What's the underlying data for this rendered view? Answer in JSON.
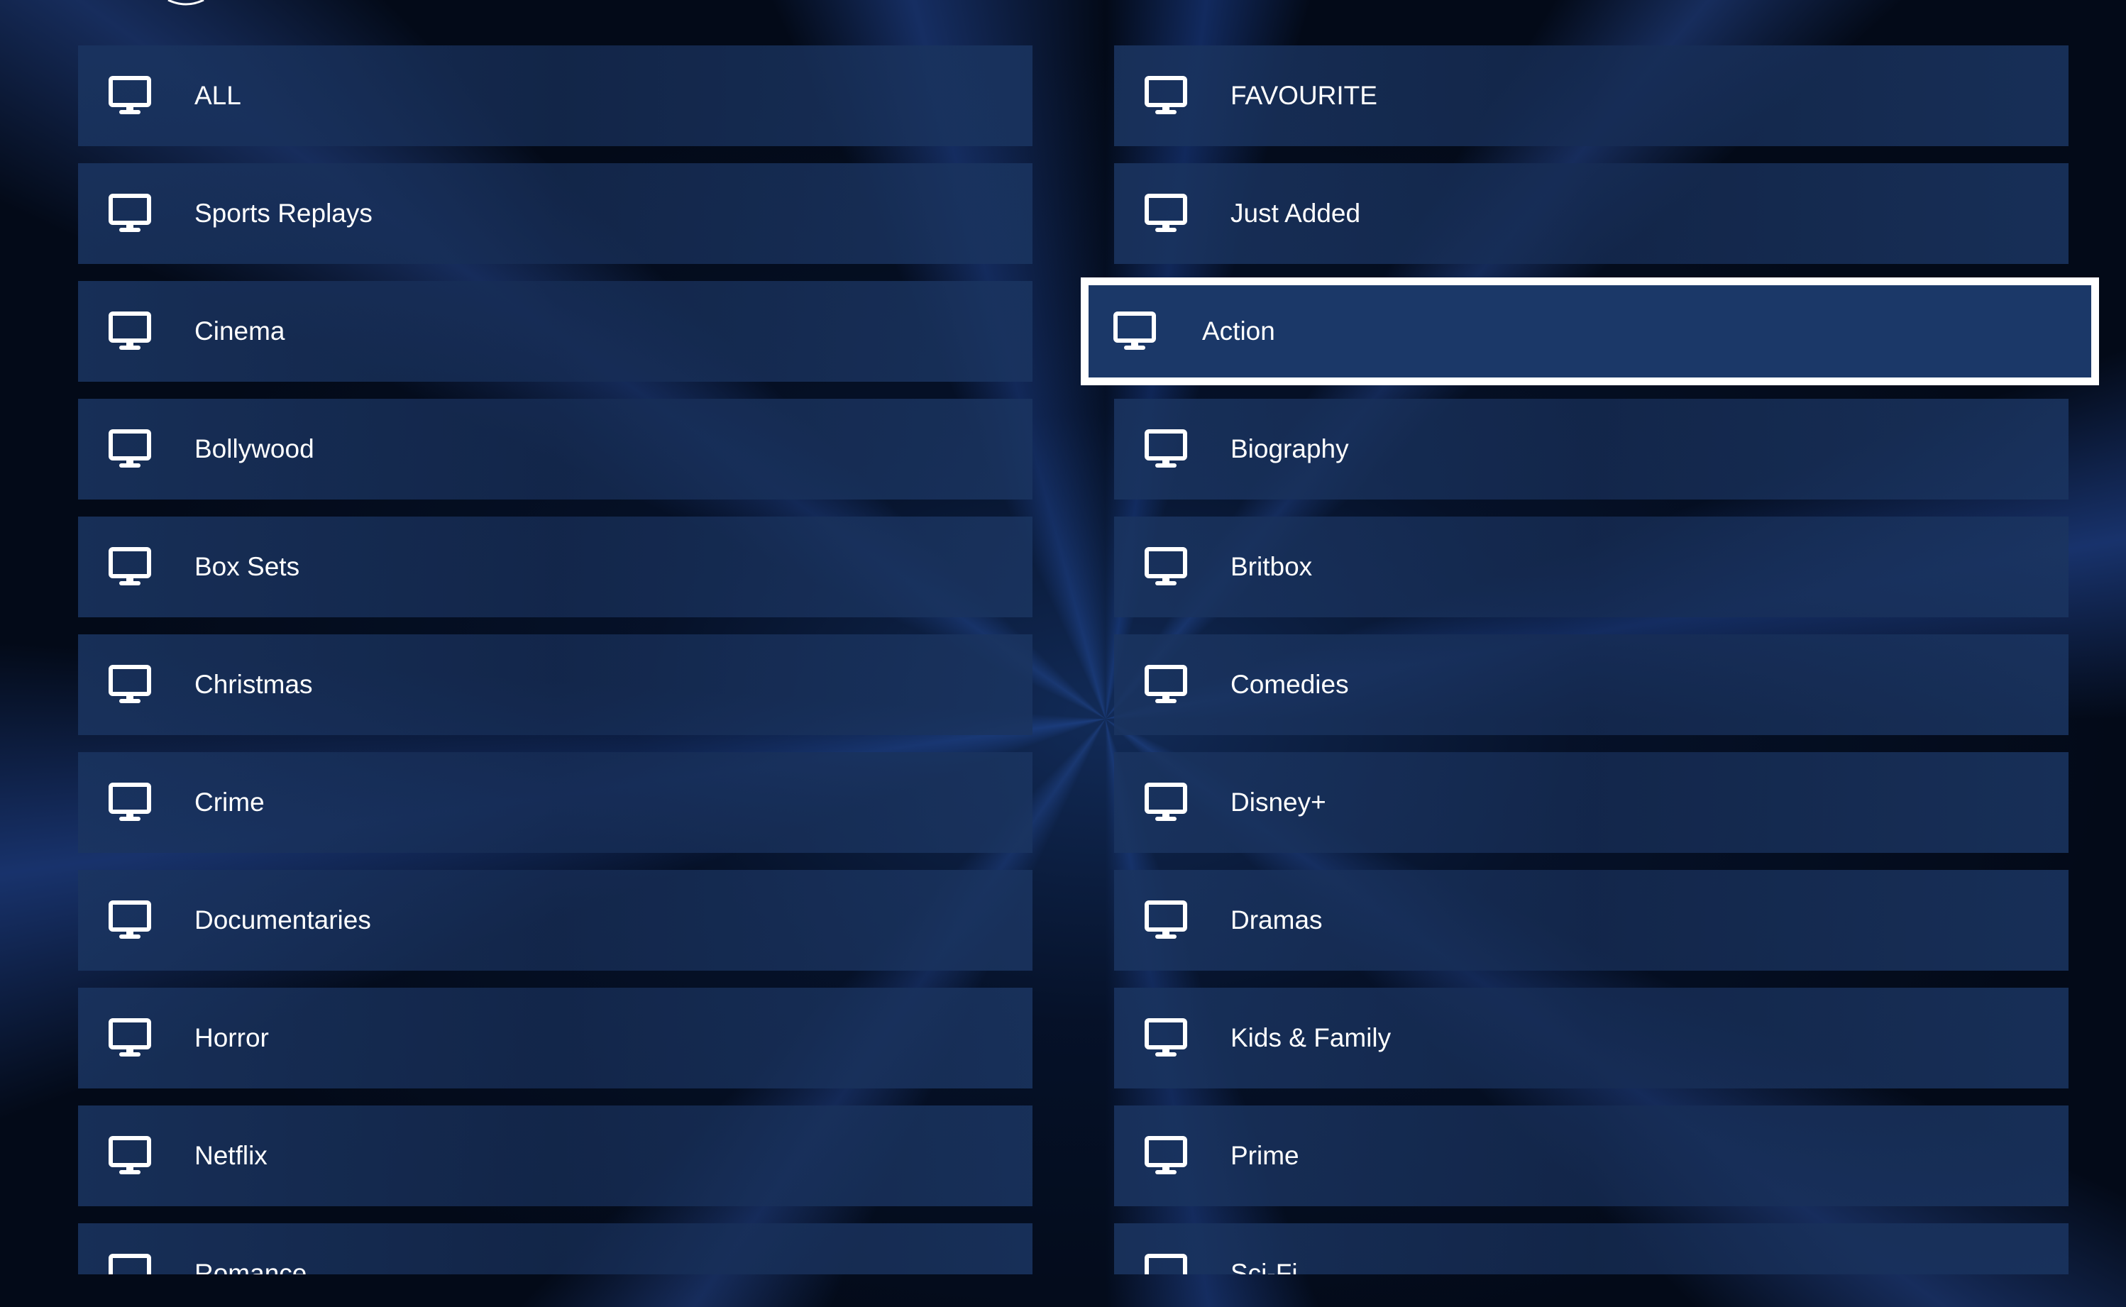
{
  "app": {
    "accent_color": "#ffffff",
    "tile_color": "#1b3868",
    "text_color": "#ffffff",
    "focused_category": "Action"
  },
  "categories": {
    "left": [
      {
        "label": "ALL",
        "icon": "monitor-icon"
      },
      {
        "label": "Sports Replays",
        "icon": "monitor-icon"
      },
      {
        "label": "Cinema",
        "icon": "monitor-icon"
      },
      {
        "label": "Bollywood",
        "icon": "monitor-icon"
      },
      {
        "label": "Box Sets",
        "icon": "monitor-icon"
      },
      {
        "label": "Christmas",
        "icon": "monitor-icon"
      },
      {
        "label": "Crime",
        "icon": "monitor-icon"
      },
      {
        "label": "Documentaries",
        "icon": "monitor-icon"
      },
      {
        "label": "Horror",
        "icon": "monitor-icon"
      },
      {
        "label": "Netflix",
        "icon": "monitor-icon"
      },
      {
        "label": "Romance",
        "icon": "monitor-icon"
      }
    ],
    "right": [
      {
        "label": "FAVOURITE",
        "icon": "monitor-icon"
      },
      {
        "label": "Just Added",
        "icon": "monitor-icon"
      },
      {
        "label": "Action",
        "icon": "monitor-icon"
      },
      {
        "label": "Biography",
        "icon": "monitor-icon"
      },
      {
        "label": "Britbox",
        "icon": "monitor-icon"
      },
      {
        "label": "Comedies",
        "icon": "monitor-icon"
      },
      {
        "label": "Disney+",
        "icon": "monitor-icon"
      },
      {
        "label": "Dramas",
        "icon": "monitor-icon"
      },
      {
        "label": "Kids & Family",
        "icon": "monitor-icon"
      },
      {
        "label": "Prime",
        "icon": "monitor-icon"
      },
      {
        "label": "Sci-Fi",
        "icon": "monitor-icon"
      }
    ]
  }
}
